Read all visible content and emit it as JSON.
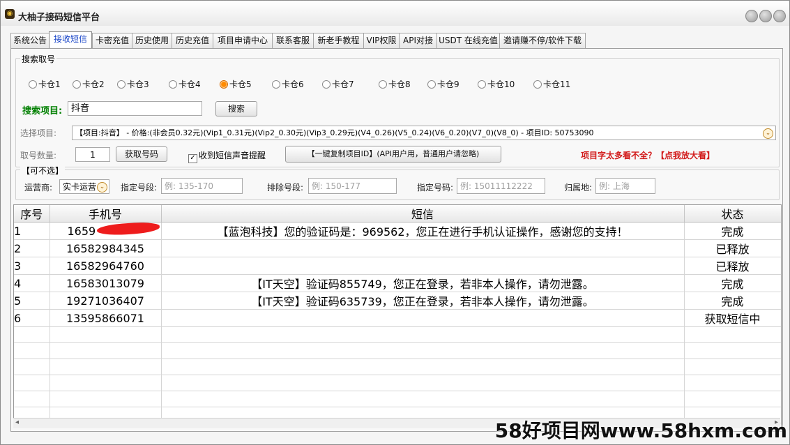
{
  "app": {
    "title": "大柚子接码短信平台"
  },
  "tabs": [
    {
      "label": "系统公告"
    },
    {
      "label": "接收短信"
    },
    {
      "label": "卡密充值"
    },
    {
      "label": "历史使用"
    },
    {
      "label": "历史充值"
    },
    {
      "label": "项目申请中心"
    },
    {
      "label": "联系客服"
    },
    {
      "label": "新老手教程"
    },
    {
      "label": "VIP权限"
    },
    {
      "label": "API对接"
    },
    {
      "label": "USDT 在线充值"
    },
    {
      "label": "邀请赚不停/软件下载"
    }
  ],
  "search": {
    "group_title": "搜索取号",
    "slots": [
      {
        "label": "卡仓1"
      },
      {
        "label": "卡仓2"
      },
      {
        "label": "卡仓3"
      },
      {
        "label": "卡仓4"
      },
      {
        "label": "卡仓5",
        "checked": true
      },
      {
        "label": "卡仓6"
      },
      {
        "label": "卡仓7"
      },
      {
        "label": "卡仓8"
      },
      {
        "label": "卡仓9"
      },
      {
        "label": "卡仓10"
      },
      {
        "label": "卡仓11"
      }
    ],
    "project_label": "搜索项目:",
    "project_value": "抖音",
    "search_button": "搜索",
    "select_label": "选择项目:",
    "select_value": "【项目:抖音】 - 价格:(非会员0.32元)(Vip1_0.31元)(Vip2_0.30元)(Vip3_0.29元)(V4_0.26)(V5_0.24)(V6_0.20)(V7_0)(V8_0) - 项目ID: 50753090",
    "qty_label": "取号数量:",
    "qty_value": "1",
    "get_button": "获取号码",
    "sound_checkbox": "收到短信声音提醒",
    "copy_button": "【一键复制项目ID】(API用户用，普通用户请忽略)",
    "zoom_notice": "项目字太多看不全？【点我放大看】"
  },
  "optional": {
    "group_title": "【可不选】",
    "carrier_label": "运营商:",
    "carrier_value": "实卡运营",
    "segment_label": "指定号段:",
    "segment_placeholder": "例: 135-170",
    "exclude_label": "排除号段:",
    "exclude_placeholder": "例: 150-177",
    "number_label": "指定号码:",
    "number_placeholder": "例: 15011112222",
    "location_label": "归属地:",
    "location_placeholder": "例: 上海"
  },
  "table": {
    "headers": {
      "idx": "序号",
      "phone": "手机号",
      "sms": "短信",
      "status": "状态"
    },
    "rows": [
      {
        "idx": "1",
        "phone": "1659",
        "sms": "【蓝泡科技】您的验证码是：969562，您正在进行手机认证操作，感谢您的支持！",
        "status": "完成"
      },
      {
        "idx": "2",
        "phone": "16582984345",
        "sms": "",
        "status": "已释放"
      },
      {
        "idx": "3",
        "phone": "16582964760",
        "sms": "",
        "status": "已释放"
      },
      {
        "idx": "4",
        "phone": "16583013079",
        "sms": "【IT天空】验证码855749，您正在登录，若非本人操作，请勿泄露。",
        "status": "完成"
      },
      {
        "idx": "5",
        "phone": "19271036407",
        "sms": "【IT天空】验证码635739，您正在登录，若非本人操作，请勿泄露。",
        "status": "完成"
      },
      {
        "idx": "6",
        "phone": "13595866071",
        "sms": "",
        "status": "获取短信中"
      }
    ]
  },
  "watermark": "58好项目网www.58hxm.com"
}
